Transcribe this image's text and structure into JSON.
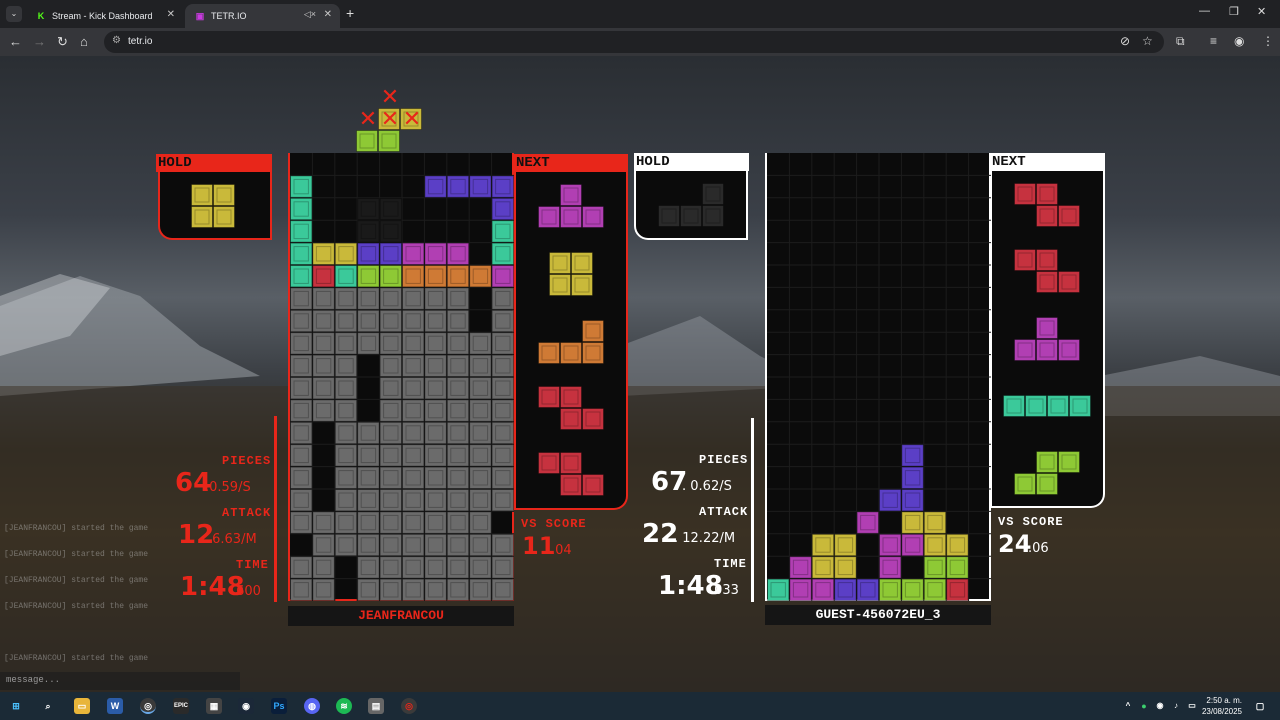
{
  "browser": {
    "tabs": [
      {
        "title": "Stream - Kick Dashboard",
        "active": false
      },
      {
        "title": "TETR.IO",
        "active": true
      }
    ],
    "url": "tetr.io"
  },
  "player1": {
    "name": "JEANFRANCOU",
    "hold_label": "HOLD",
    "next_label": "NEXT",
    "pieces_label": "PIECES",
    "pieces_value": "64",
    "pieces_rate": ".0.59/S",
    "attack_label": "ATTACK",
    "attack_value": "12",
    "attack_rate": ".6.63/M",
    "time_label": "TIME",
    "time_value": "1:48",
    "time_ms": ".600",
    "vs_label": "VS SCORE",
    "vs_value": "11",
    "vs_decimal": ".04",
    "accent": "#e8261a"
  },
  "player2": {
    "name": "GUEST-456072EU_3",
    "hold_label": "HOLD",
    "next_label": "NEXT",
    "pieces_label": "PIECES",
    "pieces_value": "67",
    "pieces_rate": ". 0.62/S",
    "attack_label": "ATTACK",
    "attack_value": "22",
    "attack_rate": ". 12.22/M",
    "time_label": "TIME",
    "time_value": "1:48",
    "time_ms": ".033",
    "vs_label": "VS SCORE",
    "vs_value": "24",
    "vs_decimal": ".06",
    "accent": "#ffffff"
  },
  "chat": {
    "placeholder": "message...",
    "lines": [
      "[JEANFRANCOU] started the game",
      "[JEANFRANCOU] started the game",
      "[JEANFRANCOU] started the game",
      "[JEANFRANCOU] started the game",
      "[JEANFRANCOU] started the game"
    ]
  },
  "taskbar": {
    "time": "2:50 a. m.",
    "date": "23/08/2025"
  },
  "colors": {
    "T": "#b13fb3",
    "O": "#c9b93a",
    "L": "#cf7a35",
    "Z": "#c6323f",
    "S": "#8ec935",
    "I": "#3bc99a",
    "J": "#5b3fc6",
    "G": "#6b6b6b"
  },
  "icons": [
    "tab-menu-icon",
    "kick-icon",
    "tetrio-icon",
    "mute-icon",
    "close-icon",
    "plus-icon",
    "back-icon",
    "forward-icon",
    "reload-icon",
    "home-icon",
    "star-icon",
    "extensions-icon",
    "windows-start-icon",
    "search-icon",
    "explorer-icon",
    "word-icon",
    "chrome-icon",
    "epic-icon",
    "minecraft-icon",
    "steam-icon",
    "photoshop-icon",
    "discord-icon",
    "spotify-icon"
  ]
}
